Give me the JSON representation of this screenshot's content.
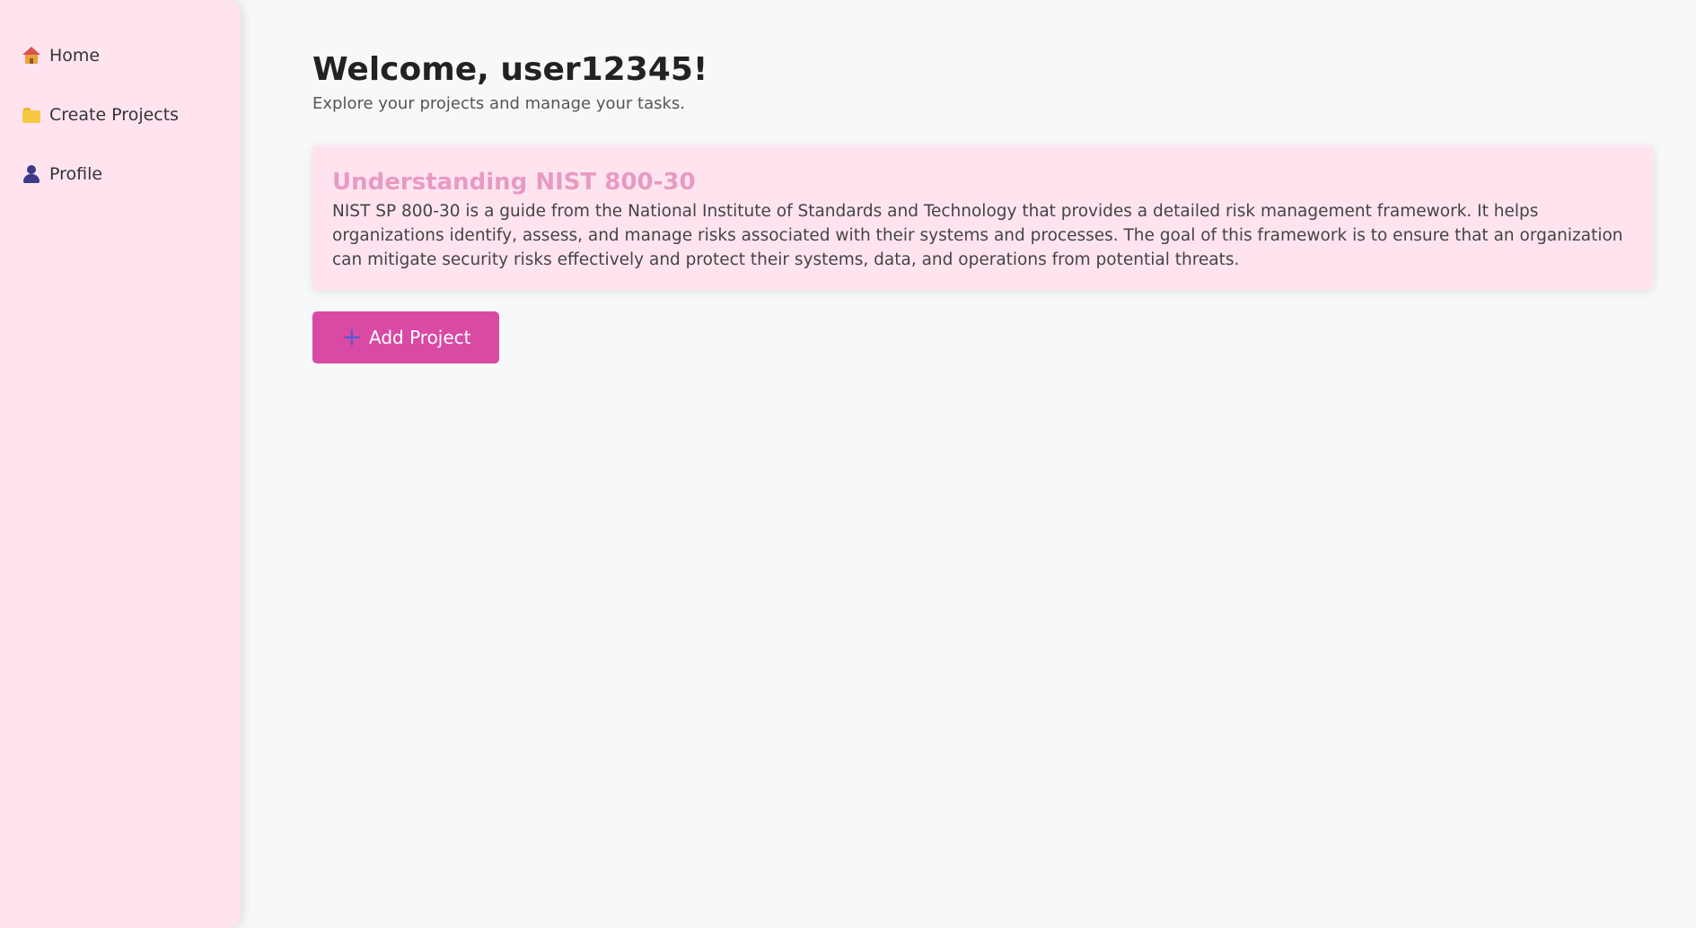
{
  "sidebar": {
    "items": [
      {
        "label": "Home",
        "icon": "house-icon"
      },
      {
        "label": "Create Projects",
        "icon": "folder-icon"
      },
      {
        "label": "Profile",
        "icon": "person-icon"
      }
    ]
  },
  "main": {
    "welcome": "Welcome, user12345!",
    "subtitle": "Explore your projects and manage your tasks.",
    "card": {
      "title": "Understanding NIST 800-30",
      "text": "NIST SP 800-30 is a guide from the National Institute of Standards and Technology that provides a detailed risk management framework. It helps organizations identify, assess, and manage risks associated with their systems and processes. The goal of this framework is to ensure that an organization can mitigate security risks effectively and protect their systems, data, and operations from potential threats."
    },
    "add_button_label": "Add Project"
  },
  "colors": {
    "sidebar_bg": "#ffe4f0",
    "page_bg": "#f7f8fa",
    "card_title": "#e89ac2",
    "button_bg": "#d94aa5"
  }
}
